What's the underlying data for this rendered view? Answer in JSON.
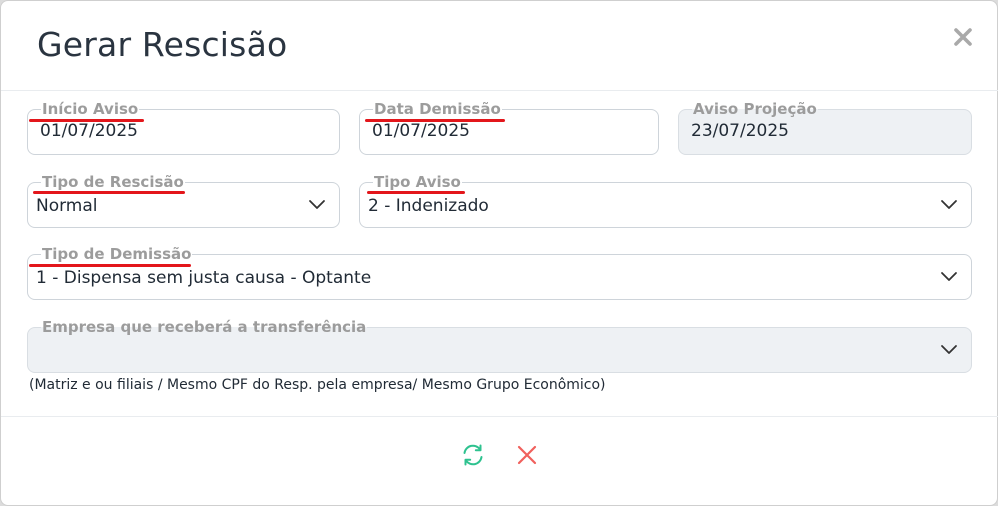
{
  "dialog": {
    "title": "Gerar Rescisão"
  },
  "fields": {
    "inicio_aviso": {
      "label": "Início Aviso",
      "value": "01/07/2025"
    },
    "data_demissao": {
      "label": "Data Demissão",
      "value": "01/07/2025"
    },
    "aviso_projecao": {
      "label": "Aviso Projeção",
      "value": "23/07/2025"
    },
    "tipo_rescisao": {
      "label": "Tipo de Rescisão",
      "value": "Normal"
    },
    "tipo_aviso": {
      "label": "Tipo Aviso",
      "value": "2 - Indenizado"
    },
    "tipo_demissao": {
      "label": "Tipo de Demissão",
      "value": "1 - Dispensa sem justa causa - Optante"
    },
    "empresa_transferencia": {
      "label": "Empresa que receberá a transferência",
      "value": ""
    }
  },
  "note": "(Matriz e ou filiais / Mesmo CPF do Resp. pela empresa/ Mesmo Grupo Econômico)",
  "icons": {
    "close": "close-icon",
    "chevron": "chevron-down-icon",
    "refresh": "refresh-icon",
    "cancel": "cancel-x-icon"
  },
  "colors": {
    "highlight": "#e3161b",
    "refresh": "#2ec28f",
    "cancel": "#f0605c",
    "label": "#9c9c9c",
    "disabled_bg": "#eef1f4"
  }
}
